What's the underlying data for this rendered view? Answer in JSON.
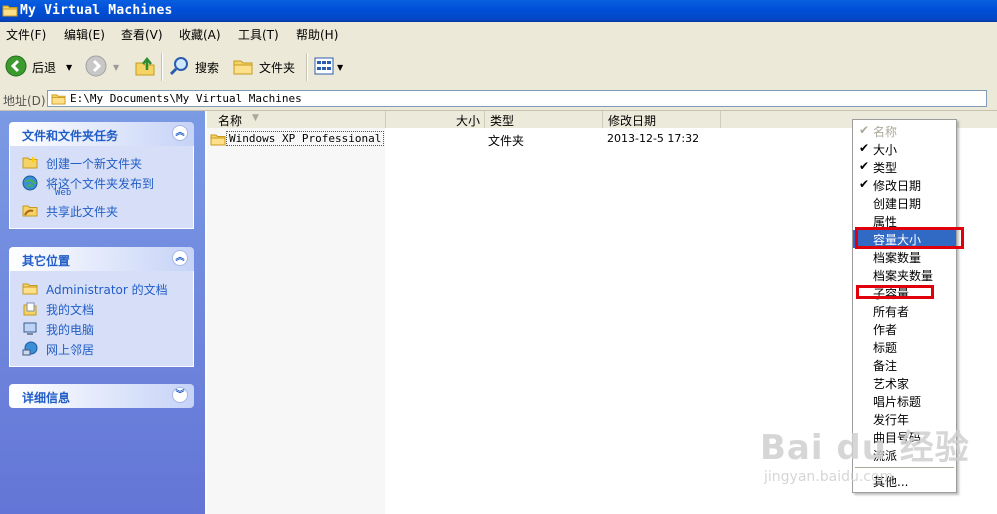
{
  "window": {
    "title": "My Virtual Machines"
  },
  "menu": [
    {
      "label": "文件(F)"
    },
    {
      "label": "编辑(E)"
    },
    {
      "label": "查看(V)"
    },
    {
      "label": "收藏(A)"
    },
    {
      "label": "工具(T)"
    },
    {
      "label": "帮助(H)"
    }
  ],
  "toolbar": {
    "back_label": "后退",
    "search_label": "搜索",
    "folders_label": "文件夹"
  },
  "address": {
    "label": "地址(D)",
    "path": "E:\\My Documents\\My Virtual Machines"
  },
  "taskpane": {
    "file_tasks": {
      "title": "文件和文件夹任务",
      "items": [
        {
          "label": "创建一个新文件夹"
        },
        {
          "label": "将这个文件夹发布到",
          "label2": "Web"
        },
        {
          "label": "共享此文件夹"
        }
      ]
    },
    "other_places": {
      "title": "其它位置",
      "items": [
        {
          "label": "Administrator 的文档"
        },
        {
          "label": "我的文档"
        },
        {
          "label": "我的电脑"
        },
        {
          "label": "网上邻居"
        }
      ]
    },
    "details": {
      "title": "详细信息"
    }
  },
  "columns": {
    "name": "名称",
    "size": "大小",
    "type": "类型",
    "modified": "修改日期"
  },
  "files": [
    {
      "name": "Windows XP Professional",
      "size": "",
      "type": "文件夹",
      "modified": "2013-12-5 17:32"
    }
  ],
  "context_menu": {
    "items": [
      {
        "label": "名称",
        "checked": true,
        "disabled": true
      },
      {
        "label": "大小",
        "checked": true
      },
      {
        "label": "类型",
        "checked": true
      },
      {
        "label": "修改日期",
        "checked": true
      },
      {
        "label": "创建日期"
      },
      {
        "label": "属性"
      },
      {
        "label": "容量大小",
        "selected": true
      },
      {
        "label": "档案数量"
      },
      {
        "label": "档案夹数量"
      },
      {
        "label": "子容量"
      },
      {
        "label": "所有者"
      },
      {
        "label": "作者"
      },
      {
        "label": "标题"
      },
      {
        "label": "备注"
      },
      {
        "label": "艺术家"
      },
      {
        "label": "唱片标题"
      },
      {
        "label": "发行年"
      },
      {
        "label": "曲目号码"
      },
      {
        "label": "流派"
      },
      {
        "label": "其他..."
      }
    ],
    "checkmark": "✔"
  },
  "watermark": {
    "logo": "Bai du 经验",
    "url": "jingyan.baidu.com"
  },
  "colors": {
    "titlebar": "#0050d8",
    "selection": "#316ac5",
    "annotation_red": "#e0000b",
    "taskpane_link": "#215dc6"
  }
}
